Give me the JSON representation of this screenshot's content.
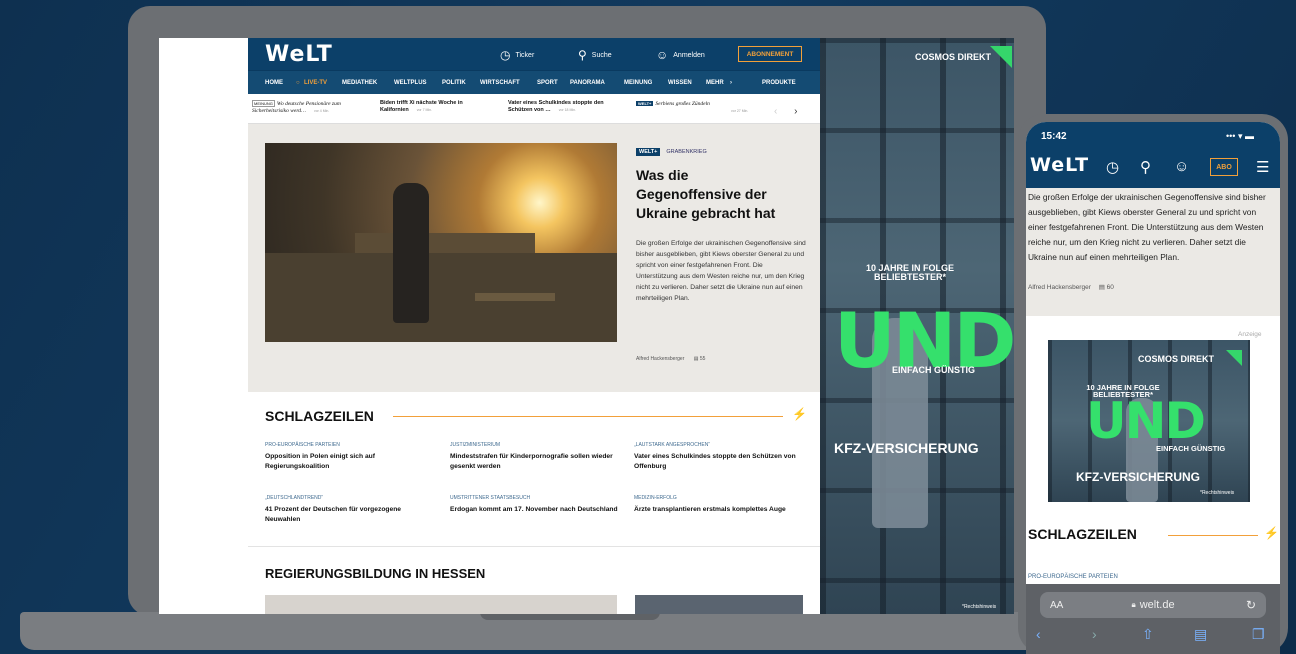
{
  "colors": {
    "brand": "#0c4069",
    "accent": "#f2a03a",
    "ad_green": "#35e06c"
  },
  "desktop": {
    "logo": "WeLT",
    "topbar": {
      "ticker": "Ticker",
      "search": "Suche",
      "login": "Anmelden",
      "abo": "ABONNEMENT"
    },
    "nav": [
      "HOME",
      "LIVE-TV",
      "MEDIATHEK",
      "WELTPLUS",
      "POLITIK",
      "WIRTSCHAFT",
      "SPORT",
      "PANORAMA",
      "MEINUNG",
      "WISSEN",
      "MEHR",
      "PRODUKTE"
    ],
    "ticker": [
      {
        "tag": "MEINUNG",
        "title": "Wo deutsche Pensionäre zum Sicherheitsrisiko werd…",
        "age": "vor 4 Min."
      },
      {
        "tag": "",
        "title": "Biden trifft Xi nächste Woche in Kalifornien",
        "age": "vor 7 Min."
      },
      {
        "tag": "",
        "title": "Vater eines Schulkindes stoppte den Schützen von …",
        "age": "vor 18 Min."
      },
      {
        "tag": "WELT+",
        "title": "Serbiens großes Zündeln",
        "age": "vor 27 Min."
      }
    ],
    "hero": {
      "badge": "WELT+",
      "kicker": "GRABENKRIEG",
      "headline": "Was die Gegenoffensive der Ukraine gebracht hat",
      "teaser": "Die großen Erfolge der ukrainischen Gegenoffensive sind bisher ausgeblieben, gibt Kiews oberster General zu und spricht von einer festgefahrenen Front. Die Unterstützung aus dem Westen reiche nur, um den Krieg nicht zu verlieren. Daher setzt die Ukraine nun auf einen mehrteiligen Plan.",
      "author": "Alfred Hackensberger",
      "comments": "55"
    },
    "schlagzeilen": {
      "title": "SCHLAGZEILEN",
      "items": [
        {
          "kicker": "PRO-EUROPÄISCHE PARTEIEN",
          "title": "Opposition in Polen einigt sich auf Regierungskoalition"
        },
        {
          "kicker": "JUSTIZMINISTERIUM",
          "title": "Mindeststrafen für Kinderpornografie sollen wieder gesenkt werden"
        },
        {
          "kicker": "„LAUTSTARK ANGESPROCHEN“",
          "title": "Vater eines Schulkindes stoppte den Schützen von Offenburg"
        },
        {
          "kicker": "„DEUTSCHLANDTREND“",
          "title": "41 Prozent der Deutschen für vorgezogene Neuwahlen"
        },
        {
          "kicker": "UMSTRITTENER STAATSBESUCH",
          "title": "Erdogan kommt am 17. November nach Deutschland"
        },
        {
          "kicker": "MEDIZIN-ERFOLG",
          "title": "Ärzte transplantieren erstmals komplettes Auge"
        }
      ]
    },
    "section2": "REGIERUNGSBILDUNG IN HESSEN",
    "ad": {
      "brand": "COSMOS DIREKT",
      "jahre": "10 JAHRE IN FOLGE BELIEBTESTER*",
      "und": "UND",
      "einfach": "EINFACH GÜNSTIG",
      "kfz": "KFZ-VERSICHERUNG",
      "recht": "*Rechtshinweis"
    }
  },
  "mobile": {
    "time": "15:42",
    "status": "••• ▾ ▬",
    "logo": "WeLT",
    "abo": "ABO",
    "teaser": "Die großen Erfolge der ukrainischen Gegenoffensive sind bisher ausgeblieben, gibt Kiews oberster General zu und spricht von einer festgefahrenen Front. Die Unterstützung aus dem Westen reiche nur, um den Krieg nicht zu verlieren. Daher setzt die Ukraine nun auf einen mehrteiligen Plan.",
    "author": "Alfred Hackensberger",
    "comments": "60",
    "anzeige": "Anzeige",
    "ad": {
      "brand": "COSMOS DIREKT",
      "jahre": "10 JAHRE IN FOLGE BELIEBTESTER*",
      "und": "UND",
      "einfach": "EINFACH GÜNSTIG",
      "kfz": "KFZ-VERSICHERUNG",
      "recht": "*Rechtshinweis"
    },
    "schlagzeilen": "SCHLAGZEILEN",
    "kicker": "PRO-EUROPÄISCHE PARTEIEN",
    "aa": "AA",
    "url": "welt.de"
  }
}
